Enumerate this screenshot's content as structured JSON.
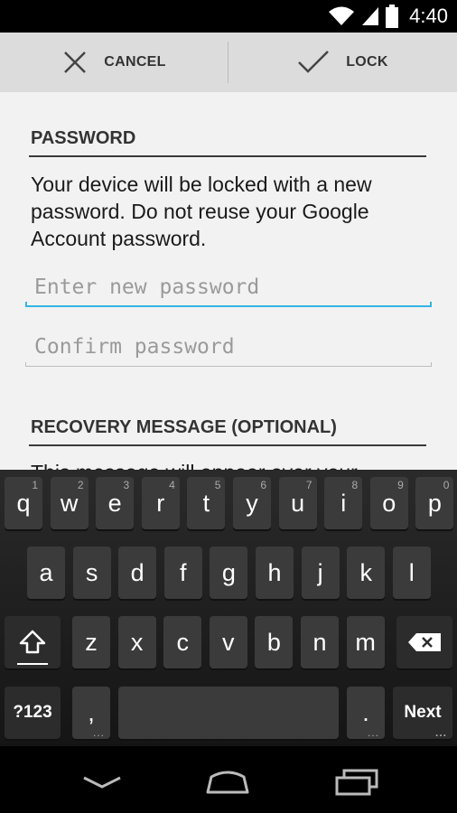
{
  "status_bar": {
    "time": "4:40",
    "icons": [
      "wifi-icon",
      "signal-icon",
      "battery-icon"
    ]
  },
  "action_bar": {
    "cancel_label": "CANCEL",
    "lock_label": "LOCK"
  },
  "password_section": {
    "title": "PASSWORD",
    "description": "Your device will be locked with a new password. Do not reuse your Google Account password.",
    "new_password_placeholder": "Enter new password",
    "confirm_password_placeholder": "Confirm password"
  },
  "recovery_section": {
    "title": "RECOVERY MESSAGE (OPTIONAL)",
    "description_partial": "This message will appear over your"
  },
  "keyboard": {
    "row1": [
      {
        "label": "q",
        "hint": "1"
      },
      {
        "label": "w",
        "hint": "2"
      },
      {
        "label": "e",
        "hint": "3"
      },
      {
        "label": "r",
        "hint": "4"
      },
      {
        "label": "t",
        "hint": "5"
      },
      {
        "label": "y",
        "hint": "6"
      },
      {
        "label": "u",
        "hint": "7"
      },
      {
        "label": "i",
        "hint": "8"
      },
      {
        "label": "o",
        "hint": "9"
      },
      {
        "label": "p",
        "hint": "0"
      }
    ],
    "row2": [
      "a",
      "s",
      "d",
      "f",
      "g",
      "h",
      "j",
      "k",
      "l"
    ],
    "row3": [
      "z",
      "x",
      "c",
      "v",
      "b",
      "n",
      "m"
    ],
    "symbols_label": "?123",
    "comma_label": ",",
    "period_label": ".",
    "next_label": "Next"
  },
  "colors": {
    "accent": "#33b5e5",
    "action_bar": "#dcdcdc",
    "content_bg": "#f2f2f2",
    "key": "#3b3b3b"
  }
}
